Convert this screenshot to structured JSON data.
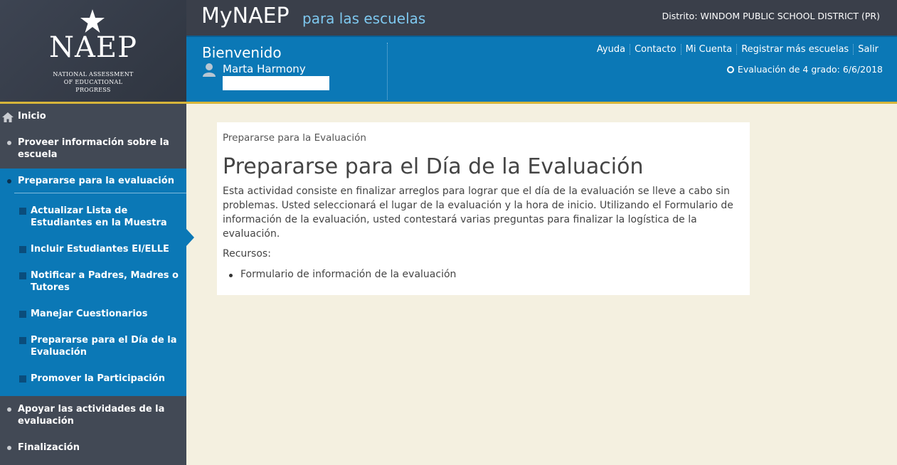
{
  "logo": {
    "brand": "NAEP",
    "subtitle_line1": "NATIONAL ASSESSMENT",
    "subtitle_line2": "OF EDUCATIONAL",
    "subtitle_line3": "PROGRESS"
  },
  "header": {
    "app_title": "MyNAEP",
    "app_subtitle": "para las escuelas",
    "district": "Distrito: WINDOM PUBLIC SCHOOL DISTRICT (PR)"
  },
  "welcome": {
    "label": "Bienvenido",
    "user_name": "Marta Harmony",
    "eval_date": "Evaluación de 4 grado: 6/6/2018"
  },
  "toplinks": [
    "Ayuda",
    "Contacto",
    "Mi Cuenta",
    "Registrar más escuelas",
    "Salir"
  ],
  "sidebar": {
    "home": "Inicio",
    "provide_info": "Proveer información sobre la escuela",
    "prepare": "Prepararse para la evaluación",
    "sub_items": [
      "Actualizar Lista de Estudiantes en la Muestra",
      "Incluir Estudiantes EI/ELLE",
      "Notificar a Padres, Madres o Tutores",
      "Manejar Cuestionarios",
      "Prepararse para el Día de la Evaluación",
      "Promover la Participación"
    ],
    "support": "Apoyar las actividades de la evaluación",
    "finish": "Finalización"
  },
  "main": {
    "breadcrumb": "Prepararse para la Evaluación",
    "heading": "Prepararse para el Día de la Evaluación",
    "description": "Esta actividad consiste en finalizar arreglos para lograr que el día de la evaluación se lleve a cabo sin problemas. Usted seleccionará el lugar de la evaluación y la hora de inicio. Utilizando el Formulario de información de la evaluación, usted contestará varias preguntas para finalizar la logística de la evaluación.",
    "resources_label": "Recursos:",
    "resources": [
      "Formulario de información de la evaluación"
    ]
  },
  "colors": {
    "primary_blue": "#0b78b6",
    "sidebar_gray": "#424955",
    "accent_gold": "#d7b53a",
    "background": "#f4f0e0"
  }
}
